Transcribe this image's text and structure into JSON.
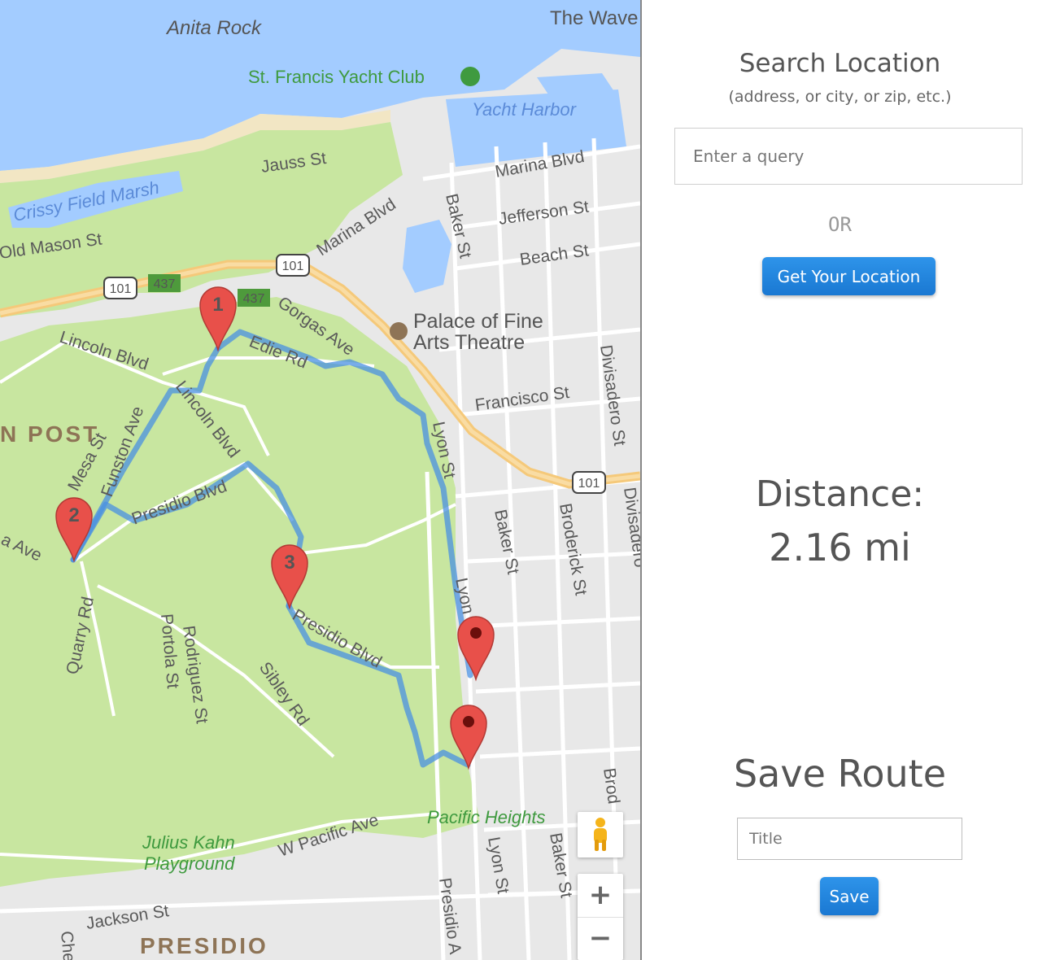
{
  "map": {
    "labels": {
      "anita_rock": "Anita Rock",
      "the_wave": "The Wave",
      "yacht_club": "St. Francis Yacht Club",
      "yacht_harbor": "Yacht Harbor",
      "crissy_marsh": "Crissy Field Marsh",
      "jauss": "Jauss St",
      "marina_blvd_right": "Marina Blvd",
      "marina_blvd_left": "Marina Blvd",
      "mason": "Old Mason St",
      "jefferson": "Jefferson St",
      "beach": "Beach St",
      "baker_top": "Baker St",
      "hwy_101_a": "101",
      "hwy_101_b": "101",
      "hwy_101_c": "101",
      "hwy_437_a": "437",
      "hwy_437_b": "437",
      "gorgas": "Gorgas Ave",
      "palace_1": "Palace of Fine",
      "palace_2": "Arts Theatre",
      "lincoln_left": "Lincoln Blvd",
      "edie": "Edie Rd",
      "lincoln_mid": "Lincoln Blvd",
      "francisco": "Francisco St",
      "divisadero_top": "Divisadero St",
      "post": "N POST",
      "mesa": "Mesa St",
      "funston": "Funston Ave",
      "lyon_top": "Lyon St",
      "presidio_blvd_upper": "Presidio Blvd",
      "baker_mid": "Baker St",
      "broderick_mid": "Broderick St",
      "divisadero_right": "Divisadero",
      "ave_left": "a Ave",
      "quarry": "Quarry Rd",
      "portola": "Portola St",
      "rodriguez": "Rodriguez St",
      "sibley": "Sibley Rd",
      "presidio_blvd_lower": "Presidio Blvd",
      "lyon_mid": "Lyon",
      "pacific_heights": "Pacific Heights",
      "w_pacific": "W Pacific Ave",
      "julius_1": "Julius Kahn",
      "julius_2": "Playground",
      "jackson": "Jackson St",
      "presidio_area": "PRESIDIO",
      "presidio_ave": "Presidio A",
      "lyon_bottom": "Lyon St",
      "baker_bottom": "Baker St",
      "broderick_bottom": "Brod",
      "che": "Che"
    },
    "markers": [
      {
        "label": "1"
      },
      {
        "label": "2"
      },
      {
        "label": "3"
      },
      {
        "label": ""
      },
      {
        "label": ""
      }
    ],
    "controls": {
      "pegman_icon": "pegman-icon",
      "zoom_in": "+",
      "zoom_out": "−"
    },
    "colors": {
      "water": "#a3ccff",
      "park": "#c8e6a0",
      "route": "#4a90e2",
      "marker": "#e8504a",
      "highway": "#f5c97a"
    }
  },
  "panel": {
    "search_title": "Search Location",
    "search_subtitle": "(address, or city, or zip, etc.)",
    "query_placeholder": "Enter a query",
    "or_text": "OR",
    "locate_button": "Get Your Location",
    "distance_label": "Distance:",
    "distance_value": "2.16 mi",
    "save_title": "Save Route",
    "title_placeholder": "Title",
    "save_button": "Save",
    "accent_color": "#1a78d2"
  }
}
